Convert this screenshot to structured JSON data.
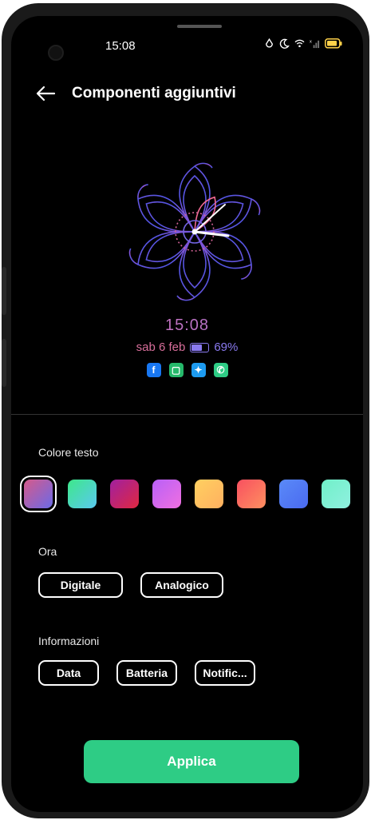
{
  "status_bar": {
    "time": "15:08"
  },
  "header": {
    "title": "Componenti aggiuntivi"
  },
  "preview": {
    "time": "15:08",
    "date": "sab 6 feb",
    "battery_percent": "69%",
    "battery_level": 0.69,
    "apps": [
      {
        "icon": "facebook-icon",
        "glyph": "f",
        "color": "#1877f2"
      },
      {
        "icon": "messages-icon",
        "glyph": "▢",
        "color": "#25b86a"
      },
      {
        "icon": "twitter-icon",
        "glyph": "✦",
        "color": "#1d9bf0"
      },
      {
        "icon": "phone-icon",
        "glyph": "✆",
        "color": "#2ecc85"
      }
    ]
  },
  "text_color": {
    "label": "Colore testo",
    "swatches": [
      {
        "name": "pink-violet",
        "from": "#d65a8a",
        "to": "#6a6ae8",
        "selected": true
      },
      {
        "name": "green-cyan",
        "from": "#3ee88a",
        "to": "#5ac8f0"
      },
      {
        "name": "purple-red",
        "from": "#a020a0",
        "to": "#e02840"
      },
      {
        "name": "violet-pink",
        "from": "#b860f8",
        "to": "#f070e0"
      },
      {
        "name": "yellow-orange",
        "from": "#ffd060",
        "to": "#ffb060"
      },
      {
        "name": "red-orange",
        "from": "#f85060",
        "to": "#ff9060"
      },
      {
        "name": "blue",
        "from": "#5a8af8",
        "to": "#4a6af0"
      },
      {
        "name": "mint",
        "from": "#70f0c8",
        "to": "#90f0e0"
      }
    ]
  },
  "ora": {
    "label": "Ora",
    "options": [
      "Digitale",
      "Analogico"
    ]
  },
  "informazioni": {
    "label": "Informazioni",
    "options": [
      "Data",
      "Batteria",
      "Notific..."
    ]
  },
  "apply_label": "Applica"
}
